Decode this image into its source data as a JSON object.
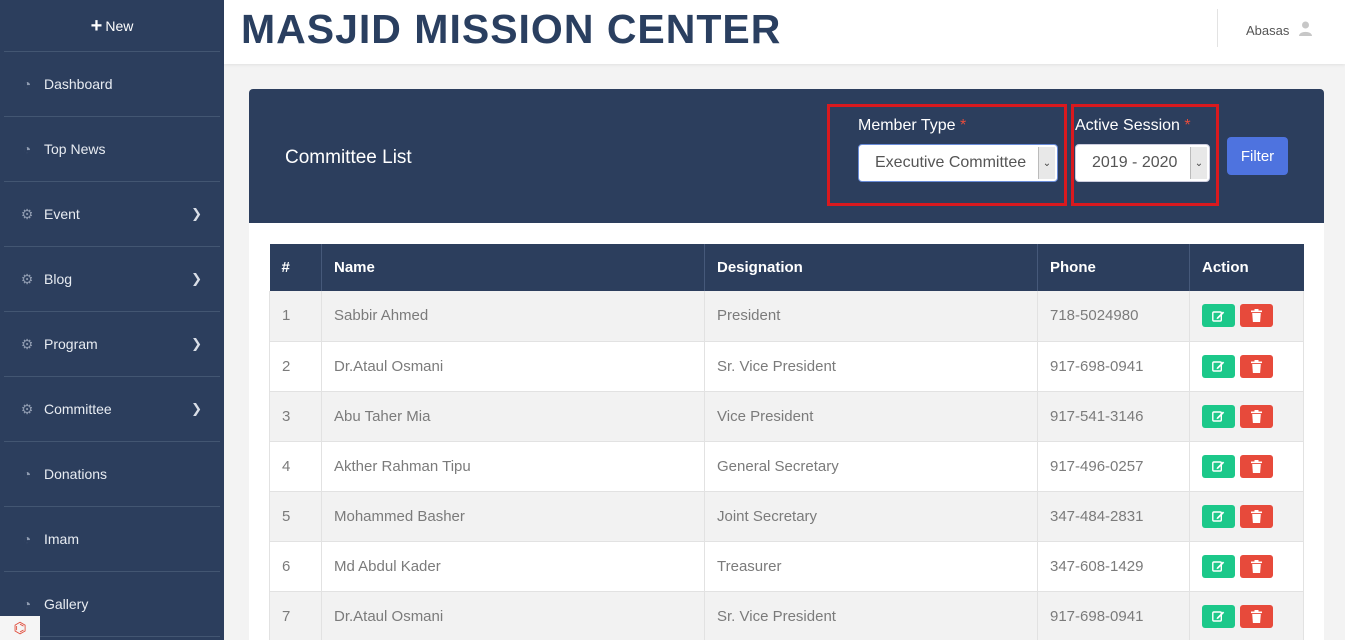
{
  "sidebar": {
    "new_label": "New",
    "items": [
      {
        "label": "Dashboard",
        "icon": "tachometer-icon",
        "has_children": false
      },
      {
        "label": "Top News",
        "icon": "tachometer-icon",
        "has_children": false
      },
      {
        "label": "Event",
        "icon": "gear-icon",
        "has_children": true
      },
      {
        "label": "Blog",
        "icon": "gear-icon",
        "has_children": true
      },
      {
        "label": "Program",
        "icon": "gear-icon",
        "has_children": true
      },
      {
        "label": "Committee",
        "icon": "gear-icon",
        "has_children": true
      },
      {
        "label": "Donations",
        "icon": "tachometer-icon",
        "has_children": false
      },
      {
        "label": "Imam",
        "icon": "tachometer-icon",
        "has_children": false
      },
      {
        "label": "Gallery",
        "icon": "tachometer-icon",
        "has_children": false
      }
    ]
  },
  "header": {
    "title": "MASJID MISSION CENTER",
    "user_name": "Abasas"
  },
  "card": {
    "title": "Committee List",
    "member_type": {
      "label": "Member Type",
      "required_mark": "*",
      "value": "Executive Committee"
    },
    "active_session": {
      "label": "Active Session",
      "required_mark": "*",
      "value": "2019 - 2020"
    },
    "filter_label": "Filter"
  },
  "table": {
    "columns": [
      "#",
      "Name",
      "Designation",
      "Phone",
      "Action"
    ],
    "rows": [
      {
        "num": "1",
        "name": "Sabbir Ahmed",
        "designation": "President",
        "phone": "718-5024980"
      },
      {
        "num": "2",
        "name": "Dr.Ataul Osmani",
        "designation": "Sr. Vice President",
        "phone": "917-698-0941"
      },
      {
        "num": "3",
        "name": "Abu Taher Mia",
        "designation": "Vice President",
        "phone": "917-541-3146"
      },
      {
        "num": "4",
        "name": "Akther Rahman Tipu",
        "designation": "General Secretary",
        "phone": "917-496-0257"
      },
      {
        "num": "5",
        "name": "Mohammed Basher",
        "designation": "Joint Secretary",
        "phone": "347-484-2831"
      },
      {
        "num": "6",
        "name": "Md Abdul Kader",
        "designation": "Treasurer",
        "phone": "347-608-1429"
      },
      {
        "num": "7",
        "name": "Dr.Ataul Osmani",
        "designation": "Sr. Vice President",
        "phone": "917-698-0941"
      }
    ]
  },
  "colors": {
    "sidebar_bg": "#2c3e5d",
    "header_title": "#2a3f60",
    "filter_button": "#4e73df",
    "edit_button": "#1cc88a",
    "delete_button": "#e74a3b",
    "highlight_box": "#d9191e"
  }
}
